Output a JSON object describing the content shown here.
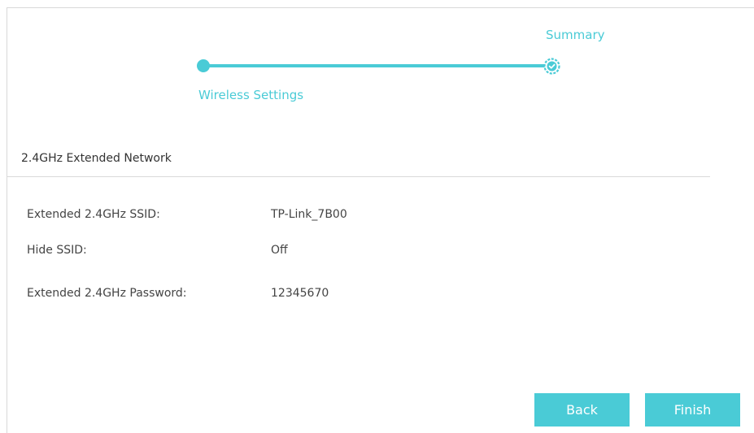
{
  "stepper": {
    "steps": [
      {
        "label": "Wireless Settings",
        "state": "completed"
      },
      {
        "label": "Summary",
        "state": "current"
      }
    ],
    "accent_color": "#4acbd6"
  },
  "section": {
    "title": "2.4GHz Extended Network"
  },
  "summary": {
    "rows": [
      {
        "label": "Extended 2.4GHz SSID:",
        "value": "TP-Link_7B00"
      },
      {
        "label": "Hide SSID:",
        "value": "Off"
      },
      {
        "label": "Extended 2.4GHz Password:",
        "value": "12345670"
      }
    ]
  },
  "buttons": {
    "back_label": "Back",
    "finish_label": "Finish",
    "color": "#4acbd6"
  },
  "icons": {
    "current_step": "check-circle-icon"
  }
}
